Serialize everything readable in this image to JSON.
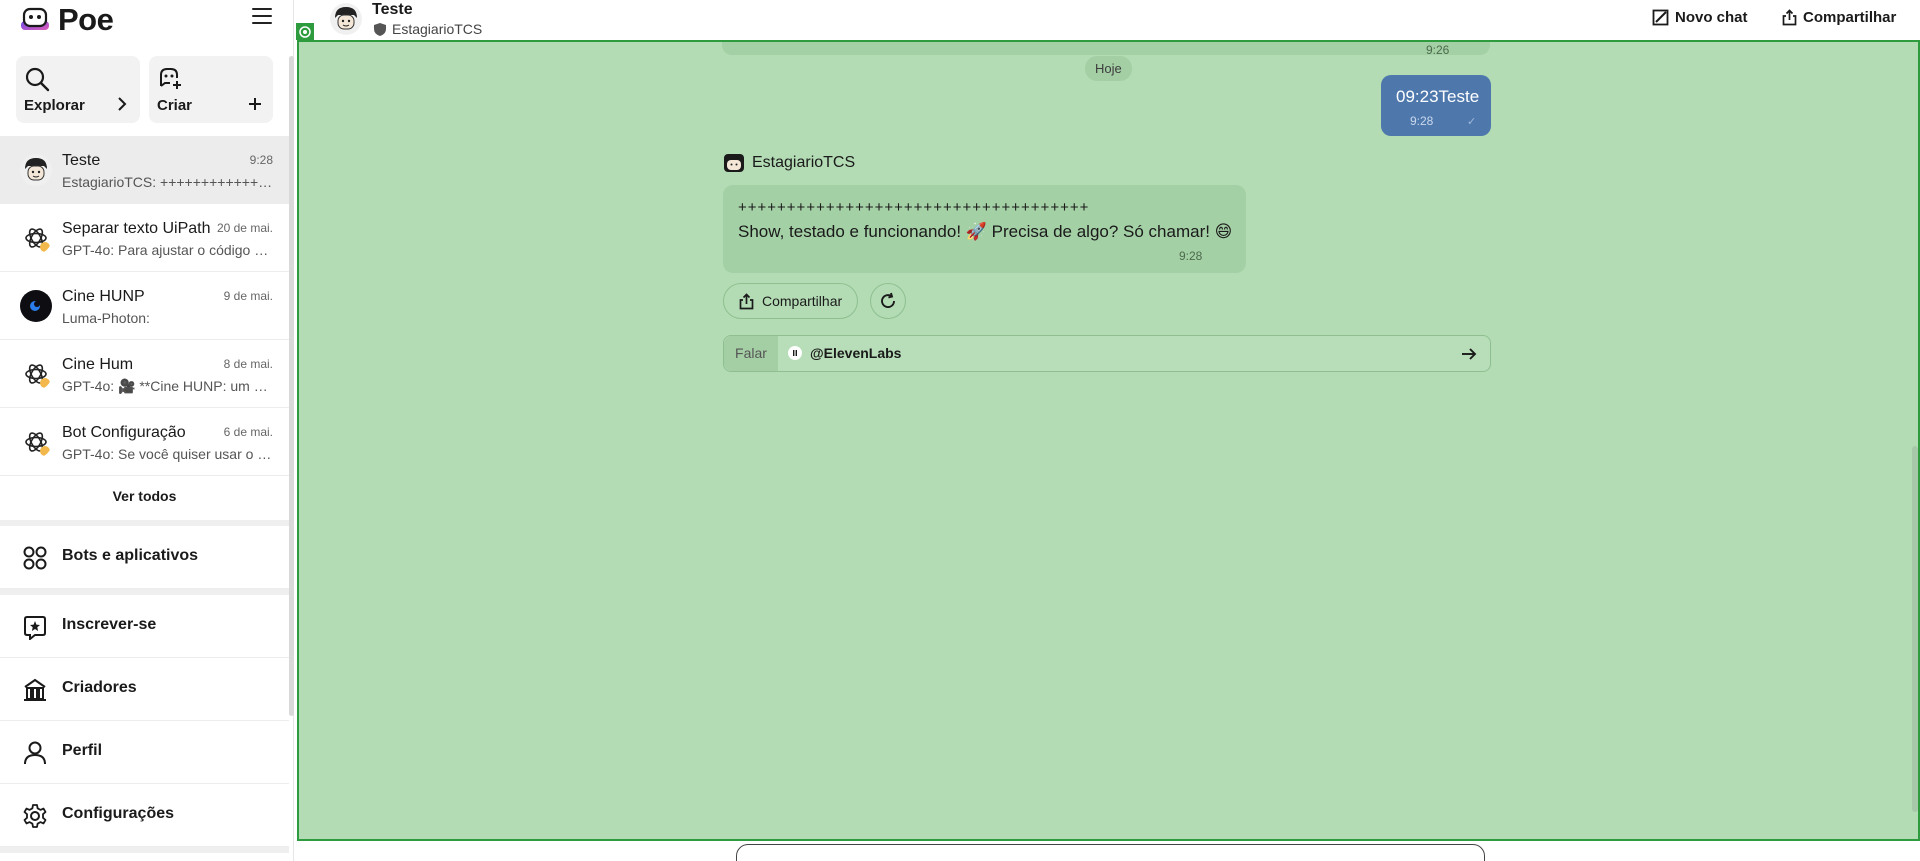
{
  "app": {
    "name": "Poe"
  },
  "sidebar": {
    "quick_actions": [
      {
        "label": "Explorar",
        "icon": "search-icon"
      },
      {
        "label": "Criar",
        "icon": "create-bot-icon"
      }
    ],
    "chats": [
      {
        "title": "Teste",
        "time": "9:28",
        "preview": "EstagiarioTCS: ++++++++++++++++++++++++++++++++++++",
        "avatar": "estagiario-avatar",
        "active": true
      },
      {
        "title": "Separar texto UiPath",
        "time": "20 de mai.",
        "preview": "GPT-4o: Para ajustar o código e ...",
        "avatar": "gpt4o-avatar",
        "active": false
      },
      {
        "title": "Cine HUNP",
        "time": "9 de mai.",
        "preview": "Luma-Photon:",
        "avatar": "luma-avatar",
        "active": false
      },
      {
        "title": "Cine Hum",
        "time": "8 de mai.",
        "preview": "GPT-4o: 🎥 **Cine HUNP: um m...",
        "avatar": "gpt4o-avatar",
        "active": false
      },
      {
        "title": "Bot Configuração",
        "time": "6 de mai.",
        "preview": "GPT-4o: Se você quiser usar o **...",
        "avatar": "gpt4o-avatar",
        "active": false
      }
    ],
    "see_all": "Ver todos",
    "nav": [
      {
        "label": "Bots e aplicativos",
        "icon": "apps-icon"
      },
      {
        "label": "Inscrever-se",
        "icon": "subscribe-icon"
      },
      {
        "label": "Criadores",
        "icon": "creators-icon"
      },
      {
        "label": "Perfil",
        "icon": "profile-icon"
      },
      {
        "label": "Configurações",
        "icon": "settings-icon"
      }
    ]
  },
  "header": {
    "title": "Teste",
    "subtitle": "EstagiarioTCS",
    "new_chat": "Novo chat",
    "share": "Compartilhar"
  },
  "conversation": {
    "previous_time": "9:26",
    "date_separator": "Hoje",
    "user_message": {
      "text": "09:23Teste",
      "time": "9:28"
    },
    "bot": {
      "name": "EstagiarioTCS",
      "line1": "++++++++++++++++++++++++++++++++++++",
      "line2": "Show, testado e funcionando! 🚀 Precisa de algo? Só chamar! 😄",
      "time": "9:28"
    },
    "share_label": "Compartilhar"
  },
  "composer": {
    "speak_label": "Falar",
    "mention": "@ElevenLabs"
  },
  "colors": {
    "chat_background": "#b3dcb4",
    "bot_bubble": "#a4d0a5",
    "user_bubble": "#4e78ac",
    "border_accent": "#2f9b3f"
  }
}
